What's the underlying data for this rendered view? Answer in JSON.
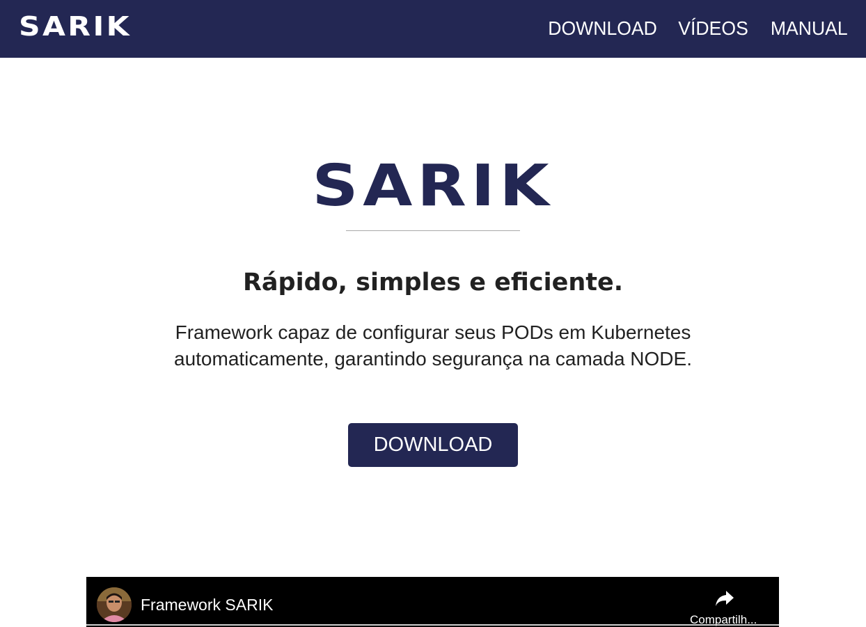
{
  "header": {
    "brand": "SARIK",
    "nav": [
      {
        "label": "DOWNLOAD"
      },
      {
        "label": "VÍDEOS"
      },
      {
        "label": "MANUAL"
      }
    ]
  },
  "hero": {
    "title": "SARIK",
    "tagline": "Rápido, simples e eficiente.",
    "description": "Framework capaz de configurar seus PODs em Kubernetes automaticamente, garantindo segurança na camada NODE.",
    "download_label": "DOWNLOAD"
  },
  "video": {
    "title": "Framework SARIK",
    "share_label": "Compartilh...",
    "share_icon": "share-arrow-icon"
  },
  "colors": {
    "primary": "#232753",
    "text": "#212121",
    "video_bg": "#000000"
  }
}
